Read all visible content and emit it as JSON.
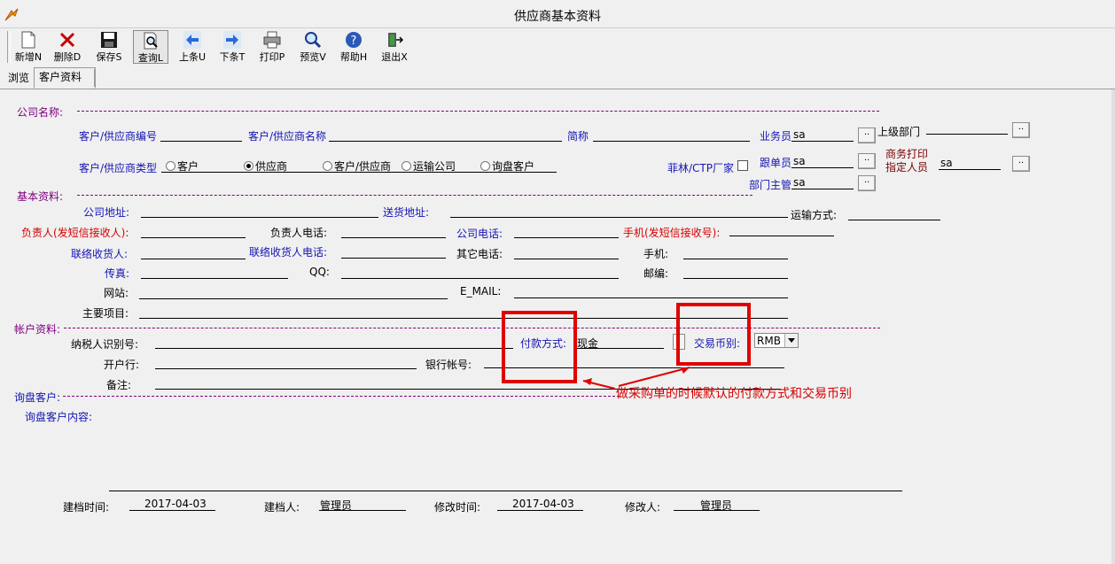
{
  "window": {
    "title": "供应商基本资料"
  },
  "toolbar": {
    "new": "新增N",
    "delete": "删除D",
    "save": "保存S",
    "query": "查询L",
    "prev": "上条U",
    "next": "下条T",
    "print": "打印P",
    "preview": "预览V",
    "help": "帮助H",
    "exit": "退出X"
  },
  "tabs": {
    "browse": "浏览",
    "customer": "客户资料"
  },
  "sections": {
    "company": "公司名称:",
    "basic": "基本资料:",
    "account": "帐户资料:",
    "inquiry": "询盘客户:",
    "inquiry_content": "询盘客户内容:"
  },
  "fields": {
    "supplier_code": "客户/供应商编号",
    "supplier_name": "客户/供应商名称",
    "short_name": "简称",
    "salesman": "业务员",
    "salesman_value": "sa",
    "parent_dept": "上级部门",
    "supplier_type": "客户/供应商类型",
    "type_options": [
      "客户",
      "供应商",
      "客户/供应商",
      "运输公司",
      "询盘客户"
    ],
    "ctp": "菲林/CTP厂家",
    "follower": "跟单员",
    "follower_value": "sa",
    "print_person_1": "商务打印",
    "print_person_2": "指定人员",
    "print_person_value": "sa",
    "dept_head": "部门主管",
    "dept_head_value": "sa",
    "company_address": "公司地址:",
    "delivery_address": "送货地址:",
    "transport": "运输方式:",
    "contact_person": "负责人(发短信接收人):",
    "contact_phone": "负责人电话:",
    "company_phone": "公司电话:",
    "mobile_sms": "手机(发短信接收号):",
    "receiver": "联络收货人:",
    "receiver_phone": "联络收货人电话:",
    "other_phone": "其它电话:",
    "mobile": "手机:",
    "fax": "传真:",
    "qq": "QQ:",
    "zip": "邮编:",
    "website": "网站:",
    "email": "E_MAIL:",
    "main_items": "主要项目:",
    "tax_id": "纳税人识别号:",
    "payment": "付款方式:",
    "payment_value": "现金",
    "currency": "交易币别:",
    "currency_value": "RMB",
    "bank": "开户行:",
    "bank_account": "银行帐号:",
    "remark": "备注:"
  },
  "annotation": "做采购单的时候默认的付款方式和交易币别",
  "footer": {
    "created_time_label": "建档时间:",
    "created_time": "2017-04-03",
    "creator_label": "建档人:",
    "creator": "管理员",
    "modified_time_label": "修改时间:",
    "modified_time": "2017-04-03",
    "modifier_label": "修改人:",
    "modifier": "管理员"
  },
  "colors": {
    "label_blue": "#1414b4",
    "label_red": "#d40000",
    "section_purple": "#800080",
    "highlight_red": "#e00000"
  }
}
